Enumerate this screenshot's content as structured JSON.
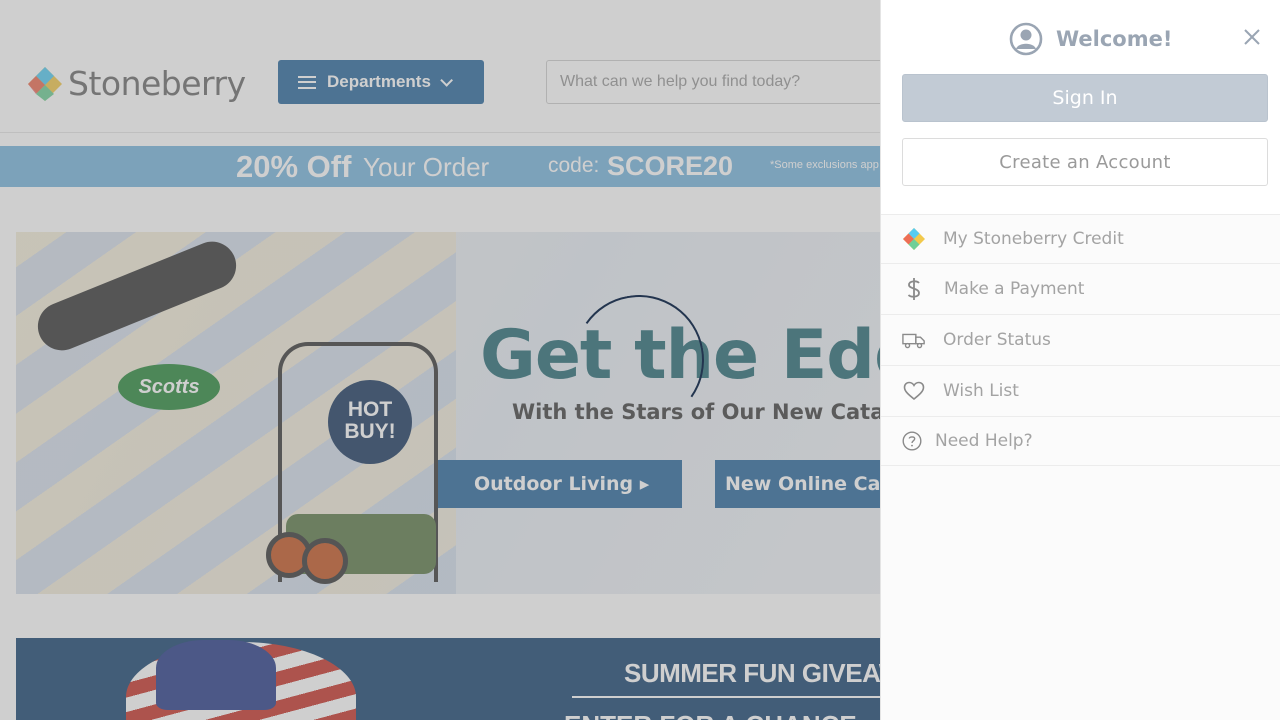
{
  "header": {
    "logo_text": "Stoneberry",
    "departments_label": "Departments",
    "search_placeholder": "What can we help you find today?"
  },
  "promo": {
    "discount": "20% Off",
    "discount_suffix": "Your Order",
    "code_label": "code:",
    "code": "SCORE20",
    "fine_print": "*Some exclusions app"
  },
  "hero": {
    "badge_brand": "Scotts",
    "hot_buy_line1": "HOT",
    "hot_buy_line2": "BUY!",
    "title": "Get the Edg",
    "subtitle": "With the Stars of Our New Catalog",
    "button_outdoor": "Outdoor Living ▸",
    "button_catalog": "New Online Ca"
  },
  "giveaway": {
    "title": "SUMMER FUN GIVEAW",
    "subtitle": "ENTER FOR A CHANCE"
  },
  "drawer": {
    "welcome": "Welcome!",
    "sign_in": "Sign In",
    "create_account": "Create an Account",
    "menu": [
      {
        "label": "My Stoneberry Credit",
        "icon": "stoneberry-logo-icon"
      },
      {
        "label": "Make a Payment",
        "icon": "dollar-icon"
      },
      {
        "label": "Order Status",
        "icon": "truck-icon"
      },
      {
        "label": "Wish List",
        "icon": "heart-icon"
      },
      {
        "label": "Need Help?",
        "icon": "question-icon"
      }
    ]
  },
  "colors": {
    "brand_blue": "#2e6b9e",
    "promo_blue": "#7ab6de",
    "sign_in_bg": "#c2cbd5",
    "spinner": "#23354f"
  }
}
